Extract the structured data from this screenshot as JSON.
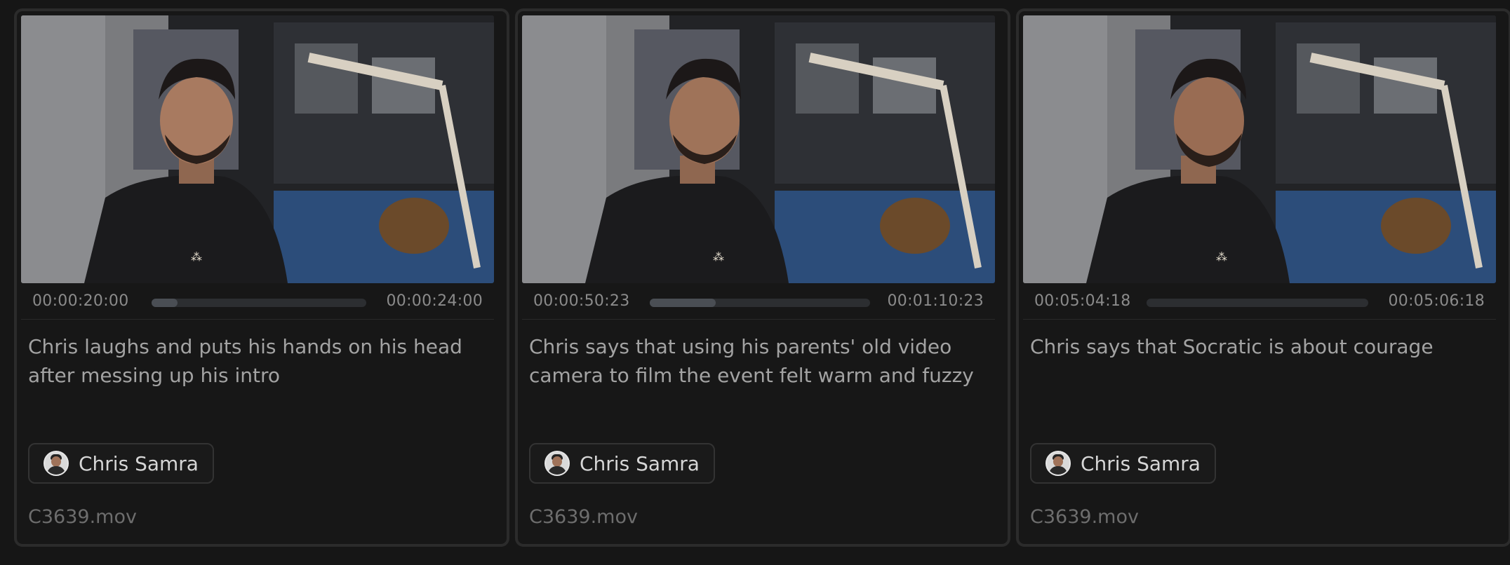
{
  "clips": [
    {
      "start": "00:00:20:00",
      "end": "00:00:24:00",
      "progress": 0.12,
      "caption": "Chris laughs and puts his hands on his head after messing up his intro",
      "person": "Chris Samra",
      "file": "C3639.mov"
    },
    {
      "start": "00:00:50:23",
      "end": "00:01:10:23",
      "progress": 0.3,
      "caption": "Chris says that using his parents' old video camera to film the event felt warm and fuzzy",
      "person": "Chris Samra",
      "file": "C3639.mov"
    },
    {
      "start": "00:05:04:18",
      "end": "00:05:06:18",
      "progress": 0.0,
      "caption": "Chris says that Socratic is about courage",
      "person": "Chris Samra",
      "file": "C3639.mov"
    }
  ],
  "icons": {
    "avatar": "person-avatar-icon"
  }
}
